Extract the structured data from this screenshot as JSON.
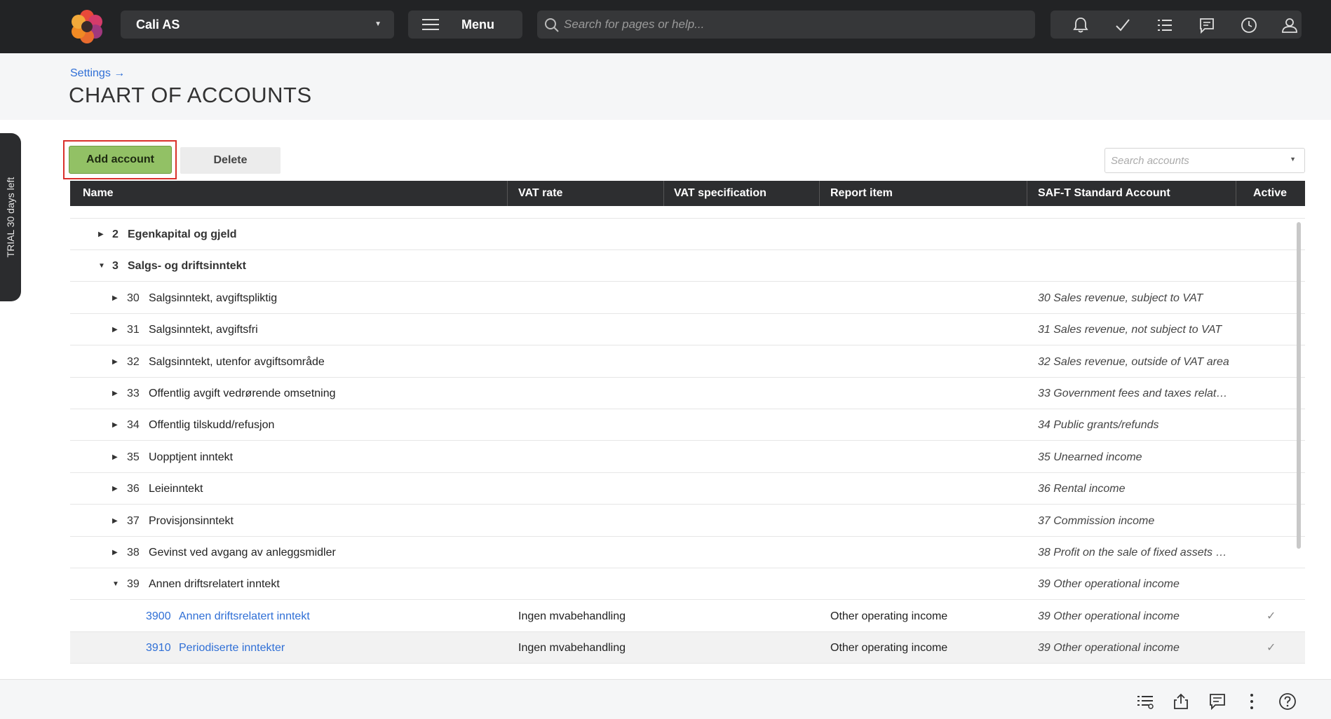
{
  "topbar": {
    "company": "Cali AS",
    "menu_label": "Menu",
    "search_placeholder": "Search for pages or help...",
    "icons": [
      "bell-icon",
      "check-icon",
      "list-icon",
      "chat-icon",
      "clock-icon",
      "user-icon"
    ]
  },
  "header": {
    "breadcrumb": "Settings",
    "breadcrumb_arrow": "→",
    "title": "CHART OF ACCOUNTS"
  },
  "trial": {
    "label": "TRIAL 30 days left"
  },
  "toolbar": {
    "add_label": "Add account",
    "delete_label": "Delete",
    "search_placeholder": "Search accounts"
  },
  "table": {
    "columns": {
      "name": "Name",
      "vat_rate": "VAT rate",
      "vat_spec": "VAT specification",
      "report_item": "Report item",
      "saft": "SAF-T Standard Account",
      "active": "Active"
    },
    "rows": [
      {
        "level": 0,
        "expanded": false,
        "number": "2",
        "name": "Egenkapital og gjeld",
        "vat_rate": "",
        "report_item": "",
        "saft": "",
        "active": ""
      },
      {
        "level": 0,
        "expanded": true,
        "number": "3",
        "name": "Salgs- og driftsinntekt",
        "vat_rate": "",
        "report_item": "",
        "saft": "",
        "active": ""
      },
      {
        "level": 1,
        "expanded": false,
        "number": "30",
        "name": "Salgsinntekt, avgiftspliktig",
        "vat_rate": "",
        "report_item": "",
        "saft": "30 Sales revenue, subject to VAT",
        "active": ""
      },
      {
        "level": 1,
        "expanded": false,
        "number": "31",
        "name": "Salgsinntekt, avgiftsfri",
        "vat_rate": "",
        "report_item": "",
        "saft": "31 Sales revenue, not subject to VAT",
        "active": ""
      },
      {
        "level": 1,
        "expanded": false,
        "number": "32",
        "name": "Salgsinntekt, utenfor avgiftsområde",
        "vat_rate": "",
        "report_item": "",
        "saft": "32 Sales revenue, outside of VAT area",
        "active": ""
      },
      {
        "level": 1,
        "expanded": false,
        "number": "33",
        "name": "Offentlig avgift vedrørende omsetning",
        "vat_rate": "",
        "report_item": "",
        "saft": "33 Government fees and taxes relat…",
        "active": ""
      },
      {
        "level": 1,
        "expanded": false,
        "number": "34",
        "name": "Offentlig tilskudd/refusjon",
        "vat_rate": "",
        "report_item": "",
        "saft": "34 Public grants/refunds",
        "active": ""
      },
      {
        "level": 1,
        "expanded": false,
        "number": "35",
        "name": "Uopptjent inntekt",
        "vat_rate": "",
        "report_item": "",
        "saft": "35 Unearned income",
        "active": ""
      },
      {
        "level": 1,
        "expanded": false,
        "number": "36",
        "name": "Leieinntekt",
        "vat_rate": "",
        "report_item": "",
        "saft": "36 Rental income",
        "active": ""
      },
      {
        "level": 1,
        "expanded": false,
        "number": "37",
        "name": "Provisjonsinntekt",
        "vat_rate": "",
        "report_item": "",
        "saft": "37 Commission income",
        "active": ""
      },
      {
        "level": 1,
        "expanded": false,
        "number": "38",
        "name": "Gevinst ved avgang av anleggsmidler",
        "vat_rate": "",
        "report_item": "",
        "saft": "38 Profit on the sale of fixed assets …",
        "active": ""
      },
      {
        "level": 1,
        "expanded": true,
        "number": "39",
        "name": "Annen driftsrelatert inntekt",
        "vat_rate": "",
        "report_item": "",
        "saft": "39 Other operational income",
        "active": ""
      },
      {
        "level": 2,
        "expanded": null,
        "number": "3900",
        "name": "Annen driftsrelatert inntekt",
        "vat_rate": "Ingen mvabehandling",
        "report_item": "Other operating income",
        "saft": "39 Other operational income",
        "active": "✓"
      },
      {
        "level": 2,
        "expanded": null,
        "number": "3910",
        "name": "Periodiserte inntekter",
        "vat_rate": "Ingen mvabehandling",
        "report_item": "Other operating income",
        "saft": "39 Other operational income",
        "active": "✓",
        "highlighted": true
      }
    ]
  },
  "footer": {
    "icons": [
      "list-settings-icon",
      "export-icon",
      "comment-icon",
      "more-vertical-icon",
      "help-icon"
    ]
  },
  "colors": {
    "topbar": "#222325",
    "add_button": "#92c165",
    "highlight_outline": "#d9302b",
    "link": "#2f6fd6"
  }
}
